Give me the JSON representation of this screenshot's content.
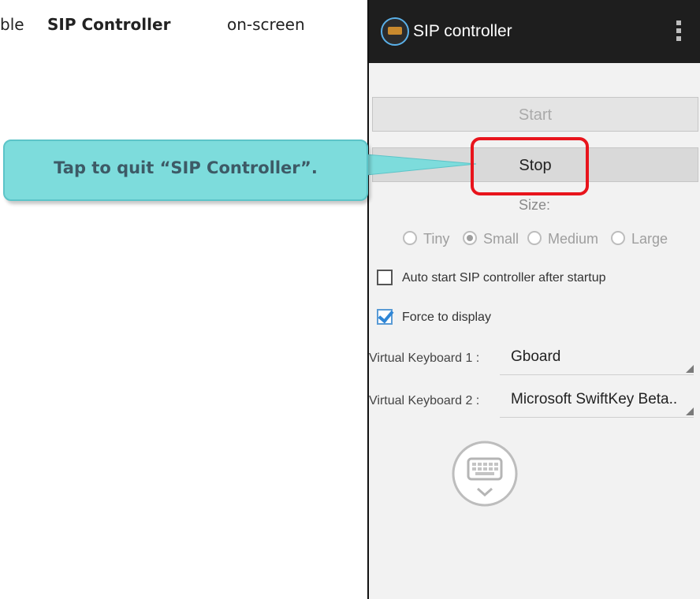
{
  "doc": {
    "prefix": "ble",
    "bold": "SIP Controller",
    "suffix": "on-screen"
  },
  "app": {
    "title": "SIP controller",
    "icons": {
      "app": "keyboard-app-icon",
      "menu": "overflow-menu-icon",
      "toggle": "keyboard-toggle-icon"
    }
  },
  "controls": {
    "start_label": "Start",
    "stop_label": "Stop",
    "size_label": "Size:",
    "sizes": [
      {
        "label": "Tiny",
        "checked": false
      },
      {
        "label": "Small",
        "checked": true
      },
      {
        "label": "Medium",
        "checked": false
      },
      {
        "label": "Large",
        "checked": false
      }
    ],
    "auto_start": {
      "label": "Auto start SIP controller after startup",
      "checked": false
    },
    "force_display": {
      "label": "Force to display",
      "checked": true
    },
    "keyboard1": {
      "label": "Virtual Keyboard 1 :",
      "value": "Gboard"
    },
    "keyboard2": {
      "label": "Virtual Keyboard 2 :",
      "value": "Microsoft SwiftKey Beta.."
    }
  },
  "callout": {
    "text": "Tap to quit “SIP Controller”."
  },
  "colors": {
    "callout_fill": "#7ddcdc",
    "highlight": "#e8141c",
    "actionbar": "#1e1e1e",
    "checkbox_accent": "#2f86d6"
  }
}
